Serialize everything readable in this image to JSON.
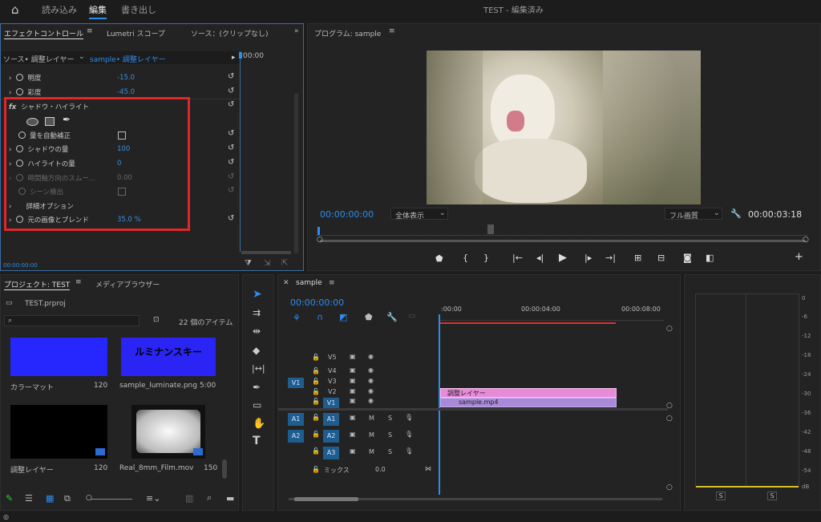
{
  "topbar": {
    "home_icon": "home-icon",
    "tab_import": "読み込み",
    "tab_edit": "編集",
    "tab_export": "書き出し",
    "title": "TEST - 編集済み"
  },
  "effect_controls": {
    "tab_effect": "エフェクトコントロール",
    "tab_lumetri": "Lumetri スコープ",
    "tab_source": "ソース：(クリップなし)",
    "source_label": "ソース• 調整レイヤー",
    "seq_label": "sample• 調整レイヤー",
    "time_ruler": "00:00",
    "rows": [
      {
        "label": "明度",
        "value": "-15.0"
      },
      {
        "label": "彩度",
        "value": "-45.0"
      }
    ],
    "fx_title": "シャドウ・ハイライト",
    "auto_amount": "量を自動補正",
    "shadow_amount_label": "シャドウの量",
    "shadow_amount": "100",
    "highlight_amount_label": "ハイライトの量",
    "highlight_amount": "0",
    "temporal_label": "時間軸方向のスムー...",
    "temporal_value": "0.00",
    "scene_detect": "シーン検出",
    "more_options": "詳細オプション",
    "blend_label": "元の画像とブレンド",
    "blend_value": "35.0",
    "blend_unit": "%",
    "footer_time": "00:00:00:00",
    "highlight_color": "#e3262a"
  },
  "program": {
    "title": "プログラム: sample",
    "timecode": "00:00:00:00",
    "fit": "全体表示",
    "quality": "フル画質",
    "duration": "00:00:03:18"
  },
  "project": {
    "tab_project": "プロジェクト: TEST",
    "tab_media": "メディアブラウザー",
    "file": "TEST.prproj",
    "item_count": "22 個のアイテム",
    "items": [
      {
        "name": "カラーマット",
        "duration": "120"
      },
      {
        "name": "sample_luminate.png",
        "duration": "5:00",
        "thumb_text": "ルミナンスキー"
      },
      {
        "name": "調整レイヤー",
        "duration": "120"
      },
      {
        "name": "Real_8mm_Film.mov",
        "duration": "150"
      }
    ]
  },
  "timeline": {
    "tab": "sample",
    "timecode": "00:00:00:00",
    "ruler": [
      ":00:00",
      "00:00:04:00",
      "00:00:08:00"
    ],
    "video_tracks": [
      "V5",
      "V4",
      "V3",
      "V2",
      "V1"
    ],
    "audio_tracks": [
      "A1",
      "A2",
      "A3"
    ],
    "clip_adjust": "調整レイヤー",
    "clip_sample": "sample.mp4",
    "mix_label": "ミックス",
    "mix_value": "0.0",
    "m": "M",
    "s": "S"
  },
  "meter": {
    "scale": [
      "0",
      "-6",
      "-12",
      "-18",
      "-24",
      "-30",
      "-36",
      "-42",
      "-48",
      "-54",
      "dB"
    ],
    "solo": "S"
  }
}
